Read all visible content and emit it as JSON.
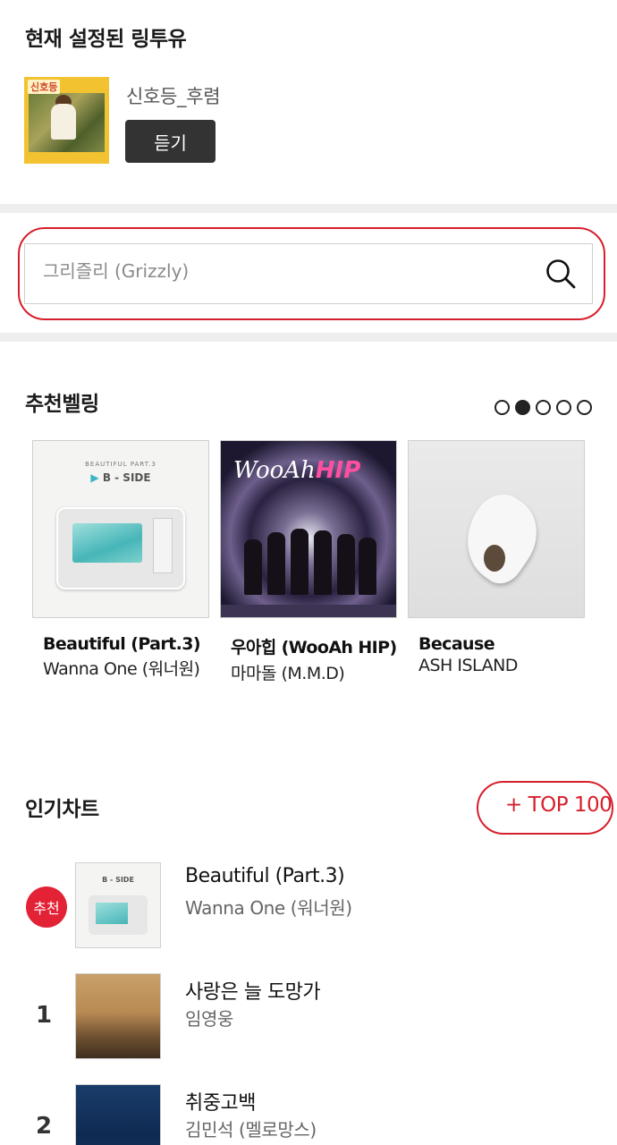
{
  "current": {
    "heading": "현재 설정된 링투유",
    "song": "신호등_후렴",
    "listen_label": "듣기",
    "art_badge": "신호등"
  },
  "search": {
    "placeholder": "그리즐리 (Grizzly)"
  },
  "recommended": {
    "heading": "추천벨링",
    "page_count": 5,
    "active_page": 2,
    "items": [
      {
        "title": "Beautiful (Part.3)",
        "artist": "Wanna One (워너원)",
        "art_label": "B - SIDE",
        "art_small": "BEAUTIFUL PART.3"
      },
      {
        "title": "우아힙 (WooAh HIP)",
        "artist": "마마돌 (M.M.D)",
        "art_label": "WooAh",
        "art_label_bold": "HIP"
      },
      {
        "title": "Because",
        "artist": "ASH ISLAND"
      }
    ]
  },
  "chart": {
    "heading": "인기차트",
    "top100_label": "+ TOP 100",
    "rows": [
      {
        "rank": "추천",
        "title": "Beautiful (Part.3)",
        "artist": "Wanna One (워너원)",
        "badge": true
      },
      {
        "rank": "1",
        "title": "사랑은 늘 도망가",
        "artist": "임영웅"
      },
      {
        "rank": "2",
        "title": "취중고백",
        "artist": "김민석 (멜로망스)"
      }
    ]
  },
  "colors": {
    "accent_red": "#d61f2c",
    "button_dark": "#333333"
  }
}
